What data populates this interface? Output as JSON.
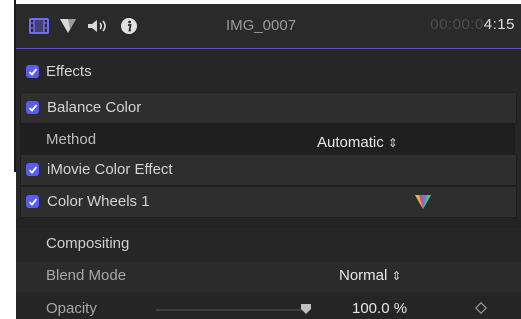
{
  "header": {
    "title": "IMG_0007",
    "timecode_dim": "00:00:0",
    "timecode_bright": "4:15",
    "icons": [
      "film-icon",
      "color-icon",
      "audio-icon",
      "info-icon"
    ]
  },
  "effects": {
    "label": "Effects",
    "checked": true,
    "items": [
      {
        "label": "Balance Color",
        "checked": true
      },
      {
        "label": "iMovie Color Effect",
        "checked": true
      },
      {
        "label": "Color Wheels 1",
        "checked": true
      }
    ],
    "method": {
      "label": "Method",
      "value": "Automatic"
    }
  },
  "compositing": {
    "label": "Compositing",
    "blend_mode": {
      "label": "Blend Mode",
      "value": "Normal"
    },
    "opacity": {
      "label": "Opacity",
      "value": "100.0",
      "unit": "%",
      "level": 1.0
    }
  },
  "colors": {
    "accent": "#5a5cf0",
    "panel_bg": "#262626",
    "header_underline": "#5b4fc8"
  }
}
